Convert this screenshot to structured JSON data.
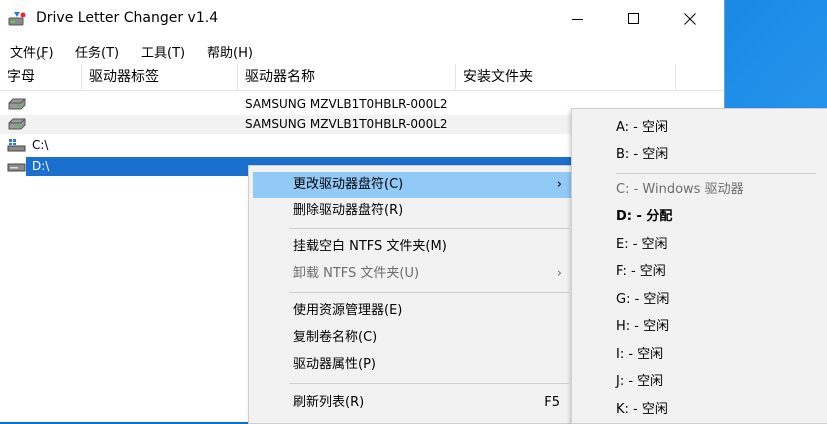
{
  "app": {
    "title": "Drive Letter Changer v1.4"
  },
  "menu": [
    "文件(F)",
    "任务(T)",
    "工具(T)",
    "帮助(H)"
  ],
  "columns": [
    "字母",
    "驱动器标签",
    "驱动器名称",
    "安装文件夹"
  ],
  "rows": [
    {
      "letter": "",
      "label": "",
      "name": "SAMSUNG MZVLB1T0HBLR-000L2",
      "folder": ""
    },
    {
      "letter": "",
      "label": "",
      "name": "SAMSUNG MZVLB1T0HBLR-000L2",
      "folder": ""
    },
    {
      "letter": "C:\\",
      "label": "",
      "name": "",
      "folder": ""
    },
    {
      "letter": "D:\\",
      "label": "",
      "name": "",
      "folder": ""
    }
  ],
  "context_menu": {
    "change_letter": "更改驱动器盘符(C)",
    "remove_letter": "删除驱动器盘符(R)",
    "mount_ntfs": "挂载空白 NTFS 文件夹(M)",
    "unmount_ntfs": "卸载 NTFS 文件夹(U)",
    "explorer": "使用资源管理器(E)",
    "copy_volume": "复制卷名称(C)",
    "properties": "驱动器属性(P)",
    "refresh": "刷新列表(R)",
    "refresh_shortcut": "F5"
  },
  "submenu": [
    "A: - 空闲",
    "B: - 空闲",
    "C: - Windows 驱动器",
    "D: - 分配",
    "E: - 空闲",
    "F: - 空闲",
    "G: - 空闲",
    "H: - 空闲",
    "I: - 空闲",
    "J: - 空闲",
    "K: - 空闲"
  ],
  "colors": {
    "selection": "#1b6fcf",
    "menu_hover": "#91c9f7",
    "desktop": "#1a8ae6"
  }
}
